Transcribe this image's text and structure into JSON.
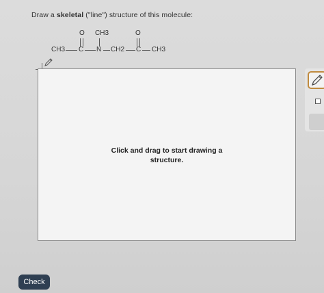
{
  "prompt": {
    "prefix": "Draw a ",
    "emphasis": "skeletal",
    "suffix": " (\"line\") structure of this molecule:"
  },
  "molecule": {
    "o1": "O",
    "ch3_top": "CH3",
    "o2": "O",
    "ch3_left": "CH3",
    "c1": "C",
    "n": "N",
    "ch2": "CH2",
    "c2": "C",
    "ch3_right": "CH3"
  },
  "canvas": {
    "hint_line1": "Click and drag to start drawing a",
    "hint_line2": "structure."
  },
  "toolbar": {
    "more_label": ":"
  },
  "actions": {
    "check_label": "Check"
  }
}
